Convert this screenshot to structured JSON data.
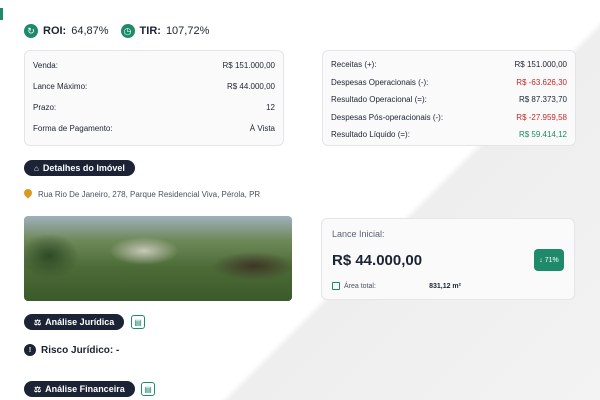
{
  "kpis": {
    "roi_label": "ROI:",
    "roi_value": "64,87%",
    "tir_label": "TIR:",
    "tir_value": "107,72%"
  },
  "summary_left": [
    {
      "label": "Venda:",
      "value": "R$ 151.000,00"
    },
    {
      "label": "Lance Máximo:",
      "value": "R$ 44.000,00"
    },
    {
      "label": "Prazo:",
      "value": "12"
    },
    {
      "label": "Forma de Pagamento:",
      "value": "À Vista"
    }
  ],
  "summary_right": [
    {
      "label": "Receitas (+):",
      "value": "R$ 151.000,00"
    },
    {
      "label": "Despesas Operacionais (-):",
      "value": "R$ -63.626,30"
    },
    {
      "label": "Resultado Operacional (=):",
      "value": "R$ 87.373,70"
    },
    {
      "label": "Despesas Pós-operacionais (-):",
      "value": "R$ -27.959,58"
    },
    {
      "label": "Resultado Líquido (=):",
      "value": "R$ 59.414,12"
    }
  ],
  "property": {
    "section_label": "Detalhes do Imóvel",
    "address": "Rua Rio De Janeiro, 278, Parque Residencial Viva, Pérola, PR"
  },
  "lance": {
    "label": "Lance Inicial:",
    "value": "R$ 44.000,00",
    "discount": "71%",
    "area_label": "Área total:",
    "area_value": "831,12 m²"
  },
  "legal": {
    "section_label": "Análise Jurídica",
    "risk_label": "Risco Jurídico: -"
  },
  "financial": {
    "section_label": "Análise Financeira"
  },
  "colors": {
    "accent": "#1e8a6a",
    "dark": "#1b2335",
    "negative": "#c62828"
  }
}
